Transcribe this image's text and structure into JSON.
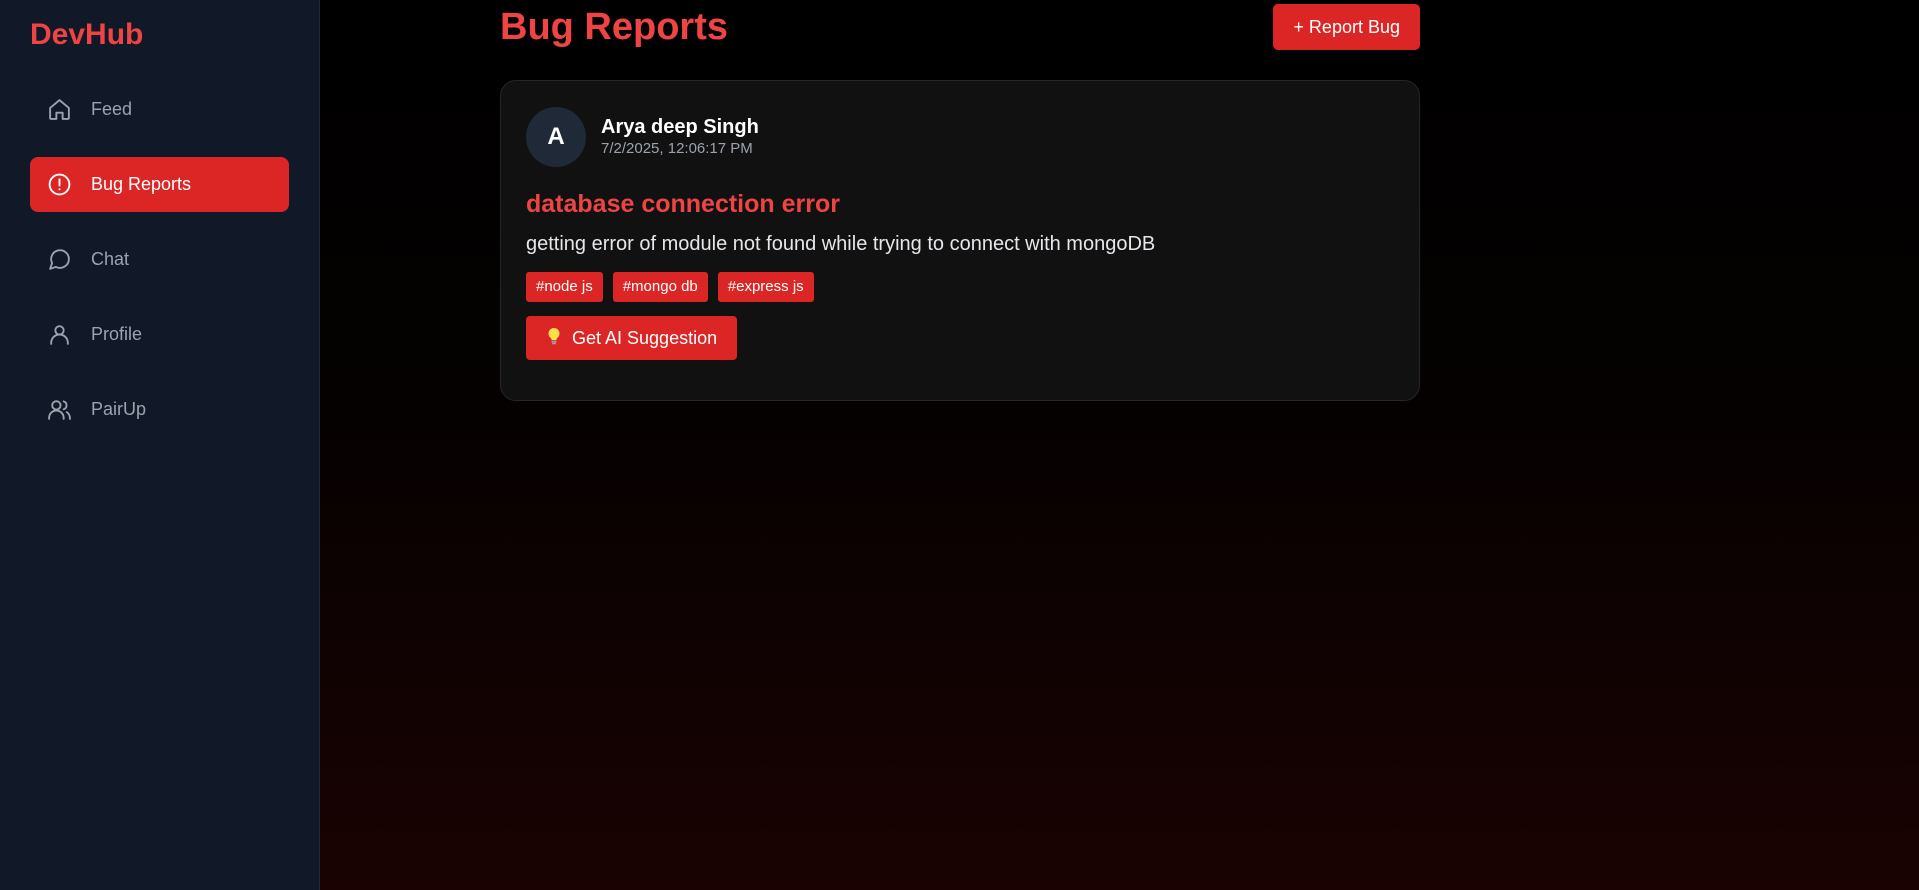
{
  "app": {
    "brand": "DevHub"
  },
  "sidebar": {
    "items": [
      {
        "label": "Feed",
        "icon": "home-icon",
        "active": false
      },
      {
        "label": "Bug Reports",
        "icon": "alert-circle-icon",
        "active": true
      },
      {
        "label": "Chat",
        "icon": "message-circle-icon",
        "active": false
      },
      {
        "label": "Profile",
        "icon": "user-icon",
        "active": false
      },
      {
        "label": "PairUp",
        "icon": "users-icon",
        "active": false
      }
    ]
  },
  "main": {
    "title": "Bug Reports",
    "report_button": "+ Report Bug",
    "bugs": [
      {
        "avatar_initial": "A",
        "author": "Arya deep Singh",
        "timestamp": "7/2/2025, 12:06:17 PM",
        "title": "database connection error",
        "description": "getting error of module not found while trying to connect with mongoDB",
        "tags": [
          "#node js",
          "#mongo db",
          "#express js"
        ],
        "ai_button": "Get AI Suggestion",
        "ai_button_icon": "lightbulb-icon"
      }
    ]
  },
  "colors": {
    "accent": "#dc2626",
    "accent_text": "#ef4444",
    "sidebar_bg": "#111827",
    "card_bg": "#111111"
  }
}
